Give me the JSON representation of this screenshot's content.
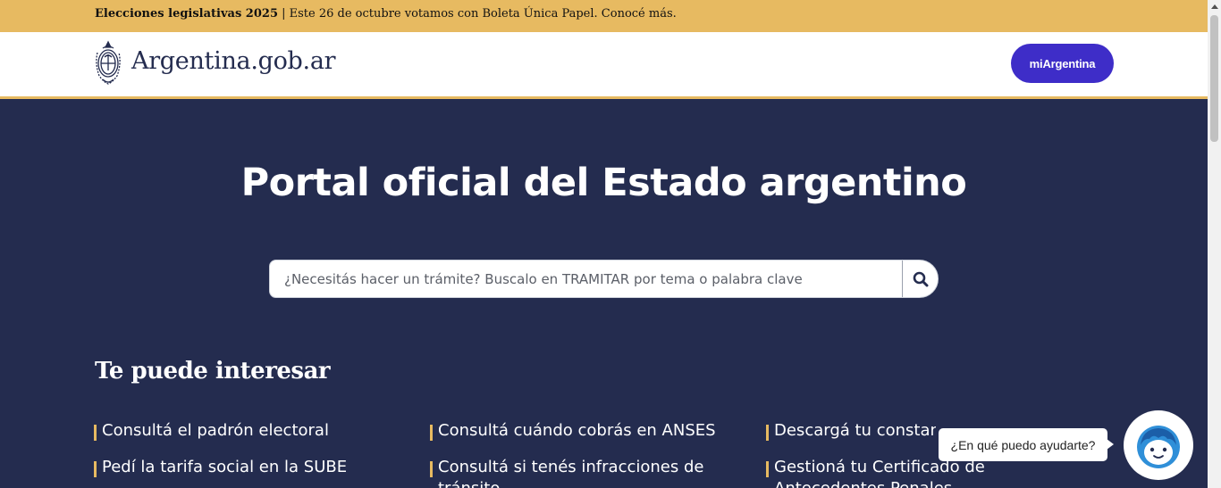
{
  "banner": {
    "bold": "Elecciones legislativas 2025",
    "rest": " | Este 26 de octubre votamos con Boleta Única Papel. Conocé más."
  },
  "header": {
    "logo_text": "Argentina.gob.ar",
    "mi_argentina": "miArgentina"
  },
  "hero": {
    "title": "Portal oficial del Estado argentino"
  },
  "search": {
    "placeholder": "¿Necesitás hacer un trámite? Buscalo en TRAMITAR por tema o palabra clave"
  },
  "section": {
    "title": "Te puede interesar",
    "links": [
      "Consultá el padrón electoral",
      "Consultá cuándo cobrás en ANSES",
      "Descargá tu constancia de CUIL",
      "Pedí la tarifa social en la SUBE",
      "Consultá si tenés infracciones de",
      "Gestioná tu Certificado de"
    ],
    "links_cont": [
      "tránsito",
      "Antecedentes Penales"
    ]
  },
  "chat": {
    "bubble": "¿En qué puedo ayudarte?"
  },
  "colors": {
    "accent": "#e7ba61",
    "navy": "#242c4f",
    "button": "#3e2dc8"
  }
}
